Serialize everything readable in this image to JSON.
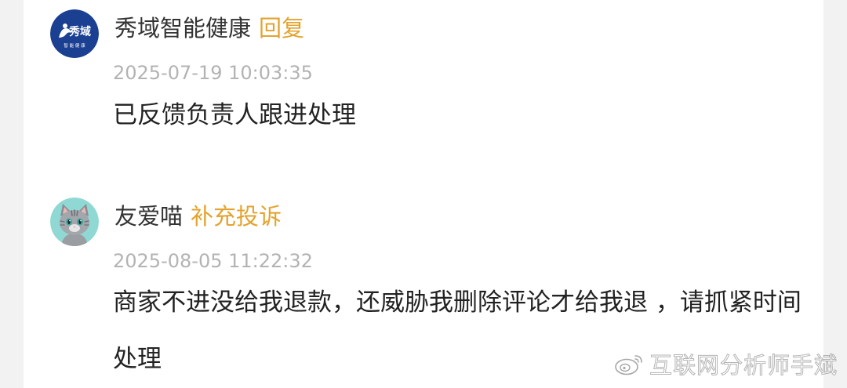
{
  "comments": [
    {
      "author": "秀域智能健康",
      "action": "回复",
      "timestamp": "2025-07-19 10:03:35",
      "text": "已反馈负责人跟进处理",
      "avatar": {
        "icon": "xiuyu-logo-icon",
        "logo_text": "秀域",
        "logo_subtext": "智 能 健 康",
        "bg_color": "#1b3f91"
      }
    },
    {
      "author": "友爱喵",
      "action": "补充投诉",
      "timestamp": "2025-08-05 11:22:32",
      "text": "商家不进没给我退款，还威胁我删除评论才给我退 ，请抓紧时间处理",
      "avatar": {
        "icon": "gray-cat-icon",
        "bg_color": "#8fd8d4"
      }
    }
  ],
  "watermark": {
    "icon": "weibo-icon",
    "text": "互联网分析师手斌"
  },
  "colors": {
    "accent": "#e3a32f",
    "timestamp": "#b3b3b3",
    "body_text": "#222222"
  }
}
